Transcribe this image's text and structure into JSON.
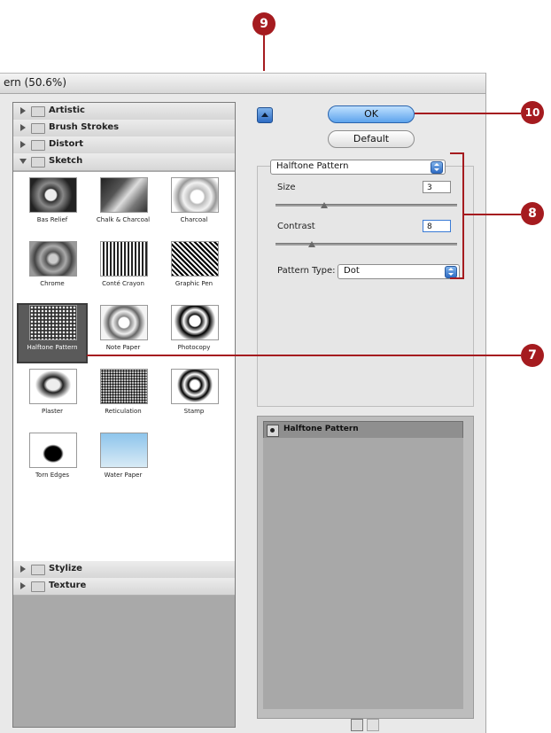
{
  "window": {
    "title": "ern (50.6%)"
  },
  "browser": {
    "categories": [
      {
        "label": "Artistic",
        "expanded": false
      },
      {
        "label": "Brush Strokes",
        "expanded": false
      },
      {
        "label": "Distort",
        "expanded": false
      },
      {
        "label": "Sketch",
        "expanded": true
      },
      {
        "label": "Stylize",
        "expanded": false
      },
      {
        "label": "Texture",
        "expanded": false
      }
    ],
    "sketch_filters": [
      "Bas Relief",
      "Chalk & Charcoal",
      "Charcoal",
      "Chrome",
      "Conté Crayon",
      "Graphic Pen",
      "Halftone Pattern",
      "Note Paper",
      "Photocopy",
      "Plaster",
      "Reticulation",
      "Stamp",
      "Torn Edges",
      "Water Paper"
    ],
    "selected_filter": "Halftone Pattern"
  },
  "buttons": {
    "ok": "OK",
    "default": "Default"
  },
  "settings": {
    "filter_select": "Halftone Pattern",
    "size": {
      "label": "Size",
      "value": "3",
      "level_fraction": 0.27
    },
    "contrast": {
      "label": "Contrast",
      "value": "8",
      "level_fraction": 0.2
    },
    "pattern_type": {
      "label": "Pattern Type:",
      "value": "Dot"
    }
  },
  "layers": {
    "items": [
      {
        "name": "Halftone Pattern"
      }
    ]
  },
  "callouts": {
    "c9": "9",
    "c10": "10",
    "c8": "8",
    "c7": "7"
  },
  "colors": {
    "callout": "#a51b1f",
    "accent": "#2e6cc4"
  }
}
